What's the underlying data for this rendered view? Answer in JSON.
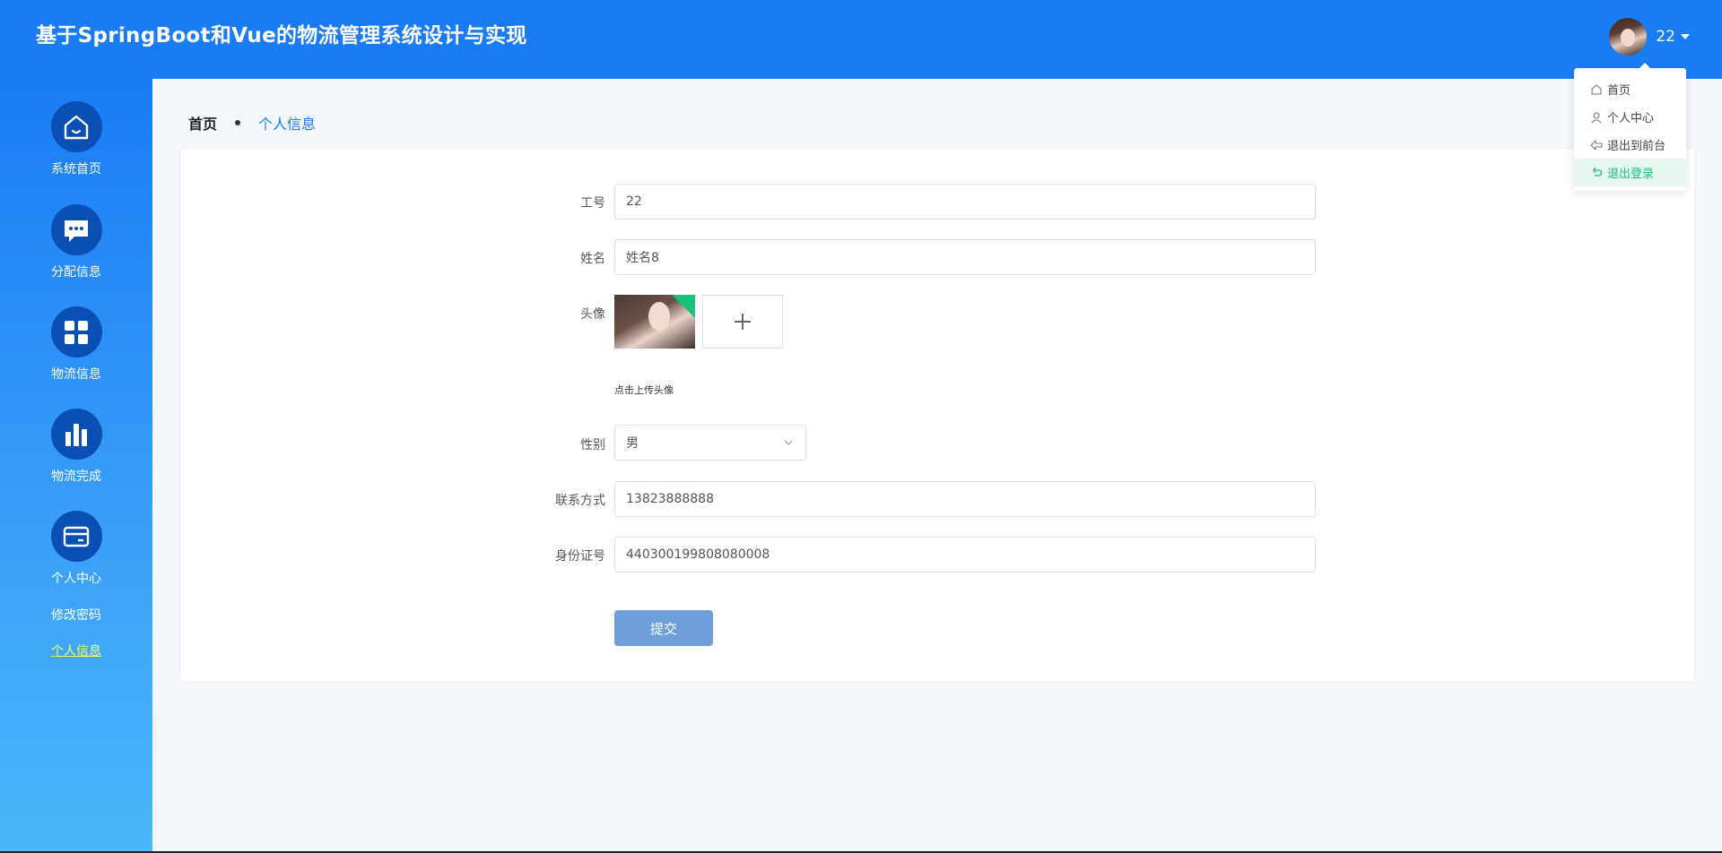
{
  "header": {
    "title": "基于SpringBoot和Vue的物流管理系统设计与实现",
    "user_name": "22",
    "accent_color": "#1a7cf5"
  },
  "sidebar": {
    "items": [
      {
        "label": "系统首页",
        "icon": "home-icon"
      },
      {
        "label": "分配信息",
        "icon": "chat-icon"
      },
      {
        "label": "物流信息",
        "icon": "grid-icon"
      },
      {
        "label": "物流完成",
        "icon": "bar-chart-icon"
      },
      {
        "label": "个人中心",
        "icon": "card-icon"
      }
    ],
    "sub_items": [
      {
        "label": "修改密码"
      },
      {
        "label": "个人信息",
        "active": true
      }
    ]
  },
  "breadcrumb": {
    "home": "首页",
    "current": "个人信息"
  },
  "form": {
    "employee_no": {
      "label": "工号",
      "value": "22"
    },
    "name": {
      "label": "姓名",
      "value": "姓名8"
    },
    "avatar": {
      "label": "头像",
      "hint": "点击上传头像"
    },
    "gender": {
      "label": "性别",
      "value": "男"
    },
    "phone": {
      "label": "联系方式",
      "value": "13823888888"
    },
    "id_number": {
      "label": "身份证号",
      "value": "440300199808080008"
    },
    "submit_label": "提交"
  },
  "dropdown": {
    "items": [
      {
        "label": "首页",
        "icon": "home-outline-icon"
      },
      {
        "label": "个人中心",
        "icon": "user-icon"
      },
      {
        "label": "退出到前台",
        "icon": "back-arrow-icon"
      },
      {
        "label": "退出登录",
        "icon": "logout-icon",
        "hovered": true
      }
    ]
  }
}
